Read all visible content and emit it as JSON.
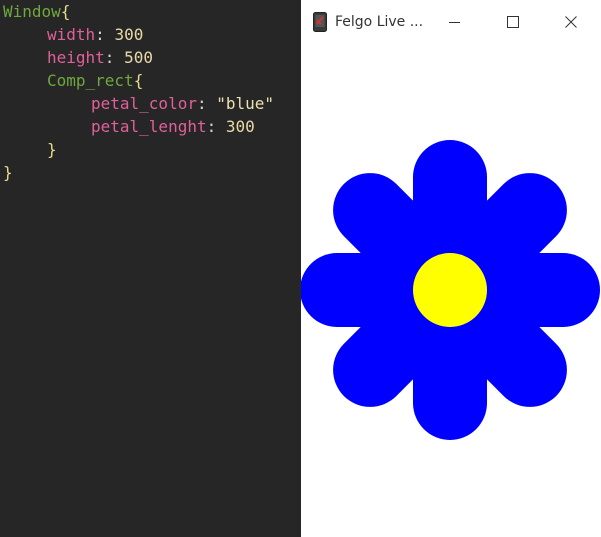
{
  "editor": {
    "lines": [
      {
        "indent": 0,
        "tokens": [
          {
            "cls": "tok-type",
            "text": "Window"
          },
          {
            "cls": "tok-brace",
            "text": "{"
          }
        ]
      },
      {
        "indent": 1,
        "tokens": [
          {
            "cls": "tok-prop",
            "text": "width"
          },
          {
            "cls": "tok-punct",
            "text": ": "
          },
          {
            "cls": "tok-num",
            "text": "300"
          }
        ]
      },
      {
        "indent": 1,
        "tokens": [
          {
            "cls": "tok-prop",
            "text": "height"
          },
          {
            "cls": "tok-punct",
            "text": ": "
          },
          {
            "cls": "tok-num",
            "text": "500"
          }
        ]
      },
      {
        "indent": 1,
        "tokens": [
          {
            "cls": "tok-type",
            "text": "Comp_rect"
          },
          {
            "cls": "tok-brace",
            "text": "{"
          }
        ]
      },
      {
        "indent": 2,
        "tokens": [
          {
            "cls": "tok-prop",
            "text": "petal_color"
          },
          {
            "cls": "tok-punct",
            "text": ": "
          },
          {
            "cls": "tok-str",
            "text": "\"blue\""
          }
        ]
      },
      {
        "indent": 2,
        "tokens": [
          {
            "cls": "tok-prop",
            "text": "petal_lenght"
          },
          {
            "cls": "tok-punct",
            "text": ": "
          },
          {
            "cls": "tok-num",
            "text": "300"
          }
        ]
      },
      {
        "indent": 1,
        "tokens": [
          {
            "cls": "tok-brace",
            "text": "}"
          }
        ]
      },
      {
        "indent": 0,
        "tokens": [
          {
            "cls": "tok-brace",
            "text": "}"
          }
        ]
      }
    ]
  },
  "preview_window": {
    "title": "Felgo Live ...",
    "icon": "felgo-app-icon",
    "controls": [
      "minimize-icon",
      "maximize-icon",
      "close-icon"
    ]
  },
  "flower": {
    "petal_color": "#0000ff",
    "center_color": "#ffff00",
    "petal_count": 8
  }
}
